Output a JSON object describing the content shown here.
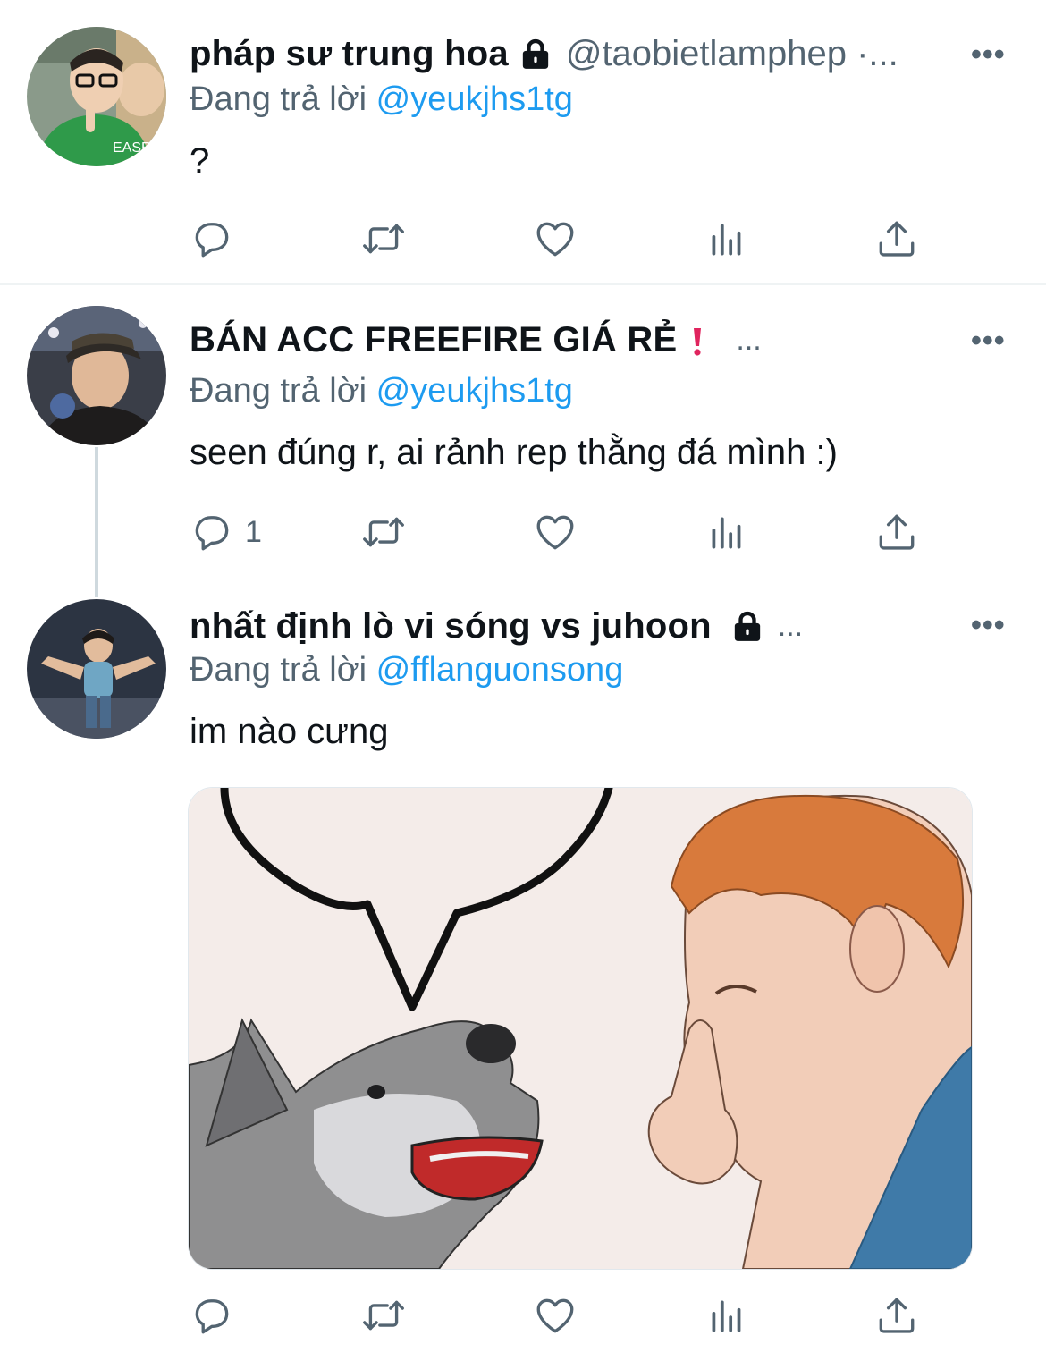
{
  "tweets": [
    {
      "display_name": "pháp sư trung hoa",
      "handle": "@taobietlamphep ·...",
      "reply_prefix": "Đang trả lời",
      "reply_to": "@yeukjhs1tg",
      "text": "?",
      "reply_count": "",
      "icons": [
        "lock-icon"
      ]
    },
    {
      "display_name": "BÁN ACC FREEFIRE GIÁ RẺ",
      "name_suffix": "...",
      "reply_prefix": "Đang trả lời",
      "reply_to": "@yeukjhs1tg",
      "text": "seen đúng r, ai rảnh rep thằng đá mình :)",
      "reply_count": "1",
      "icons": [
        "exclamation-icon"
      ]
    },
    {
      "display_name": "nhất định lò vi sóng vs juhoon",
      "name_suffix": "...",
      "reply_prefix": "Đang trả lời",
      "reply_to": "@fflanguonsong",
      "text": "im nào cưng",
      "reply_count": "",
      "icons": [
        "lock-icon",
        "media-image"
      ]
    }
  ],
  "more_label": "•••",
  "colors": {
    "link": "#1d9bf0",
    "muted": "#536471",
    "text": "#0f1419",
    "divider": "#eff3f4",
    "alert": "#e0245e"
  }
}
